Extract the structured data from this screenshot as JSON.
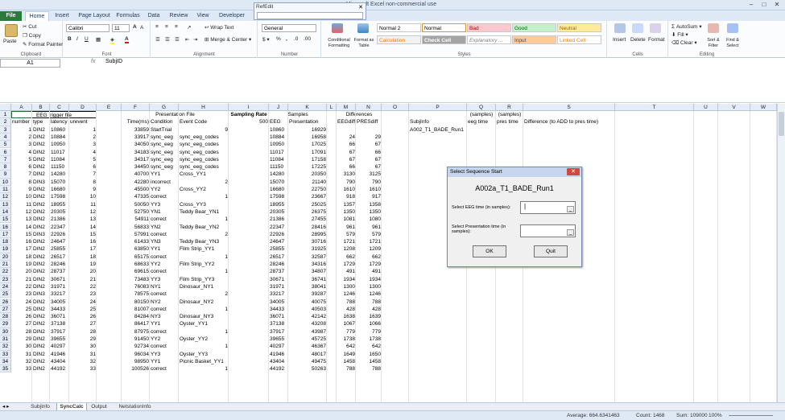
{
  "title_bar": {
    "file_tab": "File",
    "title": "c - Microsoft Excel non-commercial use"
  },
  "refedit": {
    "title": "RefEdit"
  },
  "ribbon_tabs": [
    "Home",
    "Insert",
    "Page Layout",
    "Formulas",
    "Data",
    "Review",
    "View",
    "Developer"
  ],
  "clipboard": {
    "paste": "Paste",
    "cut": "Cut",
    "copy": "Copy",
    "format_painter": "Format Painter",
    "label": "Clipboard"
  },
  "font": {
    "name": "Calibri",
    "size": "11",
    "label": "Font"
  },
  "alignment": {
    "wrap": "Wrap Text",
    "merge": "Merge & Center",
    "label": "Alignment"
  },
  "number": {
    "format": "General",
    "label": "Number"
  },
  "styles": {
    "conditional": "Conditional Formatting",
    "format_table": "Format as Table",
    "cells": [
      {
        "label": "Normal 2",
        "bg": "#ffffff",
        "color": "#000000"
      },
      {
        "label": "Normal",
        "bg": "#ffffff",
        "color": "#000000"
      },
      {
        "label": "Bad",
        "bg": "#ffc7ce",
        "color": "#9c0006"
      },
      {
        "label": "Good",
        "bg": "#c6efce",
        "color": "#006100"
      },
      {
        "label": "Neutral",
        "bg": "#ffeb9c",
        "color": "#9c6500"
      },
      {
        "label": "Calculation",
        "bg": "#f2f2f2",
        "color": "#fa7d00"
      },
      {
        "label": "Check Cell",
        "bg": "#a5a5a5",
        "color": "#ffffff"
      },
      {
        "label": "Explanatory ...",
        "bg": "#ffffff",
        "color": "#7f7f7f"
      },
      {
        "label": "Input",
        "bg": "#ffcc99",
        "color": "#3f3f76"
      },
      {
        "label": "Linked Cell",
        "bg": "#ffffff",
        "color": "#fa7d00"
      }
    ],
    "label": "Styles"
  },
  "cells_group": {
    "insert": "Insert",
    "delete": "Delete",
    "format": "Format",
    "label": "Cells"
  },
  "editing": {
    "autosum": "AutoSum",
    "fill": "Fill",
    "clear": "Clear",
    "sort": "Sort & Filter",
    "find": "Find & Select",
    "label": "Editing"
  },
  "formula_bar": {
    "name_box": "A1",
    "fx": "fx",
    "content": "SubjID"
  },
  "columns": [
    "A",
    "B",
    "C",
    "D",
    "E",
    "F",
    "G",
    "H",
    "I",
    "J",
    "K",
    "L",
    "M",
    "N",
    "O",
    "P",
    "Q",
    "R",
    "S",
    "T",
    "U",
    "V",
    "W"
  ],
  "header_row1": {
    "eeg": "EEG trigger file",
    "pres": "Presentation File",
    "sampling_rate": "Sampling Rate",
    "samples": "Samples",
    "differences": "Differences",
    "q": "(samples)",
    "r": "(samples)"
  },
  "header_row2": {
    "a": "number",
    "b": "type",
    "c": "latency",
    "d": "urevent",
    "f": "Time(ms)",
    "g": "Condition",
    "h": "Event Code",
    "i": "500",
    "j": "EEG",
    "k": "Presentation",
    "m": "EEGdiff",
    "n": "PRESdiff",
    "p": "SubjInfo",
    "q": "eeg time",
    "r": "pres time",
    "s": "Difference (to ADD to pres time)"
  },
  "p3": "A002_T1_BADE_Run1",
  "rows": [
    {
      "a": "1",
      "b": "DIN2",
      "c": "10860",
      "d": "1",
      "f": "33859",
      "g": "StartTrial",
      "h": "",
      "hn": "9",
      "j": "10860",
      "k": "16929",
      "m": "",
      "n": ""
    },
    {
      "a": "2",
      "b": "DIN2",
      "c": "10884",
      "d": "2",
      "f": "33917",
      "g": "sync_eeg",
      "h": "sync_eeg_codes",
      "hn": "",
      "j": "10884",
      "k": "16958",
      "m": "24",
      "n": "29"
    },
    {
      "a": "3",
      "b": "DIN2",
      "c": "10950",
      "d": "3",
      "f": "34050",
      "g": "sync_eeg",
      "h": "sync_eeg_codes",
      "hn": "",
      "j": "10950",
      "k": "17025",
      "m": "66",
      "n": "67"
    },
    {
      "a": "4",
      "b": "DIN2",
      "c": "11017",
      "d": "4",
      "f": "34183",
      "g": "sync_eeg",
      "h": "sync_eeg_codes",
      "hn": "",
      "j": "11017",
      "k": "17091",
      "m": "67",
      "n": "66"
    },
    {
      "a": "5",
      "b": "DIN2",
      "c": "11084",
      "d": "5",
      "f": "34317",
      "g": "sync_eeg",
      "h": "sync_eeg_codes",
      "hn": "",
      "j": "11084",
      "k": "17158",
      "m": "67",
      "n": "67"
    },
    {
      "a": "6",
      "b": "DIN2",
      "c": "11150",
      "d": "6",
      "f": "34450",
      "g": "sync_eeg",
      "h": "sync_eeg_codes",
      "hn": "",
      "j": "11150",
      "k": "17225",
      "m": "66",
      "n": "67"
    },
    {
      "a": "7",
      "b": "DIN2",
      "c": "14280",
      "d": "7",
      "f": "40700",
      "g": "YY1",
      "h": "Cross_YY1",
      "hn": "",
      "j": "14280",
      "k": "20350",
      "m": "3130",
      "n": "3125"
    },
    {
      "a": "8",
      "b": "DIN3",
      "c": "15070",
      "d": "8",
      "f": "42280",
      "g": "incorrect",
      "h": "",
      "hn": "2",
      "j": "15070",
      "k": "21140",
      "m": "790",
      "n": "790"
    },
    {
      "a": "9",
      "b": "DIN2",
      "c": "16680",
      "d": "9",
      "f": "45500",
      "g": "YY2",
      "h": "Cross_YY2",
      "hn": "",
      "j": "16680",
      "k": "22750",
      "m": "1610",
      "n": "1610"
    },
    {
      "a": "10",
      "b": "DIN2",
      "c": "17598",
      "d": "10",
      "f": "47335",
      "g": "correct",
      "h": "",
      "hn": "1",
      "j": "17598",
      "k": "23667",
      "m": "918",
      "n": "917"
    },
    {
      "a": "11",
      "b": "DIN2",
      "c": "18955",
      "d": "11",
      "f": "50050",
      "g": "YY3",
      "h": "Cross_YY3",
      "hn": "",
      "j": "18955",
      "k": "25025",
      "m": "1357",
      "n": "1358"
    },
    {
      "a": "12",
      "b": "DIN2",
      "c": "20305",
      "d": "12",
      "f": "52750",
      "g": "YN1",
      "h": "Teddy Bear_YN1",
      "hn": "",
      "j": "20305",
      "k": "26375",
      "m": "1350",
      "n": "1350"
    },
    {
      "a": "13",
      "b": "DIN2",
      "c": "21386",
      "d": "13",
      "f": "54911",
      "g": "correct",
      "h": "",
      "hn": "1",
      "j": "21386",
      "k": "27455",
      "m": "1081",
      "n": "1080"
    },
    {
      "a": "14",
      "b": "DIN2",
      "c": "22347",
      "d": "14",
      "f": "56833",
      "g": "YN2",
      "h": "Teddy Bear_YN2",
      "hn": "",
      "j": "22347",
      "k": "28416",
      "m": "961",
      "n": "961"
    },
    {
      "a": "15",
      "b": "DIN3",
      "c": "22926",
      "d": "15",
      "f": "57991",
      "g": "correct",
      "h": "",
      "hn": "2",
      "j": "22926",
      "k": "28995",
      "m": "579",
      "n": "579"
    },
    {
      "a": "16",
      "b": "DIN2",
      "c": "24647",
      "d": "16",
      "f": "61433",
      "g": "YN3",
      "h": "Teddy Bear_YN3",
      "hn": "",
      "j": "24647",
      "k": "30716",
      "m": "1721",
      "n": "1721"
    },
    {
      "a": "17",
      "b": "DIN2",
      "c": "25855",
      "d": "17",
      "f": "63850",
      "g": "YY1",
      "h": "Film Strip_YY1",
      "hn": "",
      "j": "25855",
      "k": "31925",
      "m": "1208",
      "n": "1209"
    },
    {
      "a": "18",
      "b": "DIN2",
      "c": "26517",
      "d": "18",
      "f": "65175",
      "g": "correct",
      "h": "",
      "hn": "1",
      "j": "26517",
      "k": "32587",
      "m": "662",
      "n": "662"
    },
    {
      "a": "19",
      "b": "DIN2",
      "c": "28246",
      "d": "19",
      "f": "68633",
      "g": "YY2",
      "h": "Film Strip_YY2",
      "hn": "",
      "j": "28246",
      "k": "34316",
      "m": "1729",
      "n": "1729"
    },
    {
      "a": "20",
      "b": "DIN2",
      "c": "28737",
      "d": "20",
      "f": "69615",
      "g": "correct",
      "h": "",
      "hn": "1",
      "j": "28737",
      "k": "34807",
      "m": "491",
      "n": "491"
    },
    {
      "a": "21",
      "b": "DIN2",
      "c": "30671",
      "d": "21",
      "f": "73483",
      "g": "YY3",
      "h": "Film Strip_YY3",
      "hn": "",
      "j": "30671",
      "k": "36741",
      "m": "1934",
      "n": "1934"
    },
    {
      "a": "22",
      "b": "DIN2",
      "c": "31971",
      "d": "22",
      "f": "76083",
      "g": "NY1",
      "h": "Dinosaur_NY1",
      "hn": "",
      "j": "31971",
      "k": "38041",
      "m": "1300",
      "n": "1300"
    },
    {
      "a": "23",
      "b": "DIN3",
      "c": "33217",
      "d": "23",
      "f": "78575",
      "g": "correct",
      "h": "",
      "hn": "2",
      "j": "33217",
      "k": "39287",
      "m": "1246",
      "n": "1246"
    },
    {
      "a": "24",
      "b": "DIN2",
      "c": "34005",
      "d": "24",
      "f": "80150",
      "g": "NY2",
      "h": "Dinosaur_NY2",
      "hn": "",
      "j": "34005",
      "k": "40075",
      "m": "788",
      "n": "788"
    },
    {
      "a": "25",
      "b": "DIN2",
      "c": "34433",
      "d": "25",
      "f": "81007",
      "g": "correct",
      "h": "",
      "hn": "1",
      "j": "34433",
      "k": "40503",
      "m": "428",
      "n": "428"
    },
    {
      "a": "26",
      "b": "DIN2",
      "c": "36071",
      "d": "26",
      "f": "84284",
      "g": "NY3",
      "h": "Dinosaur_NY3",
      "hn": "",
      "j": "36071",
      "k": "42142",
      "m": "1638",
      "n": "1639"
    },
    {
      "a": "27",
      "b": "DIN2",
      "c": "37138",
      "d": "27",
      "f": "86417",
      "g": "YY1",
      "h": "Oyster_YY1",
      "hn": "",
      "j": "37138",
      "k": "43208",
      "m": "1067",
      "n": "1066"
    },
    {
      "a": "28",
      "b": "DIN2",
      "c": "37917",
      "d": "28",
      "f": "87975",
      "g": "correct",
      "h": "",
      "hn": "1",
      "j": "37917",
      "k": "43987",
      "m": "779",
      "n": "779"
    },
    {
      "a": "29",
      "b": "DIN2",
      "c": "39655",
      "d": "29",
      "f": "91450",
      "g": "YY2",
      "h": "Oyster_YY2",
      "hn": "",
      "j": "39655",
      "k": "45725",
      "m": "1738",
      "n": "1738"
    },
    {
      "a": "30",
      "b": "DIN2",
      "c": "40297",
      "d": "30",
      "f": "92734",
      "g": "correct",
      "h": "",
      "hn": "1",
      "j": "40297",
      "k": "46367",
      "m": "642",
      "n": "642"
    },
    {
      "a": "31",
      "b": "DIN2",
      "c": "41946",
      "d": "31",
      "f": "96034",
      "g": "YY3",
      "h": "Oyster_YY3",
      "hn": "",
      "j": "41946",
      "k": "48017",
      "m": "1649",
      "n": "1650"
    },
    {
      "a": "32",
      "b": "DIN2",
      "c": "43404",
      "d": "32",
      "f": "98950",
      "g": "YY1",
      "h": "Picnic Basket_YY1",
      "hn": "",
      "j": "43404",
      "k": "49475",
      "m": "1458",
      "n": "1458"
    },
    {
      "a": "33",
      "b": "DIN2",
      "c": "44192",
      "d": "33",
      "f": "100526",
      "g": "correct",
      "h": "",
      "hn": "1",
      "j": "44192",
      "k": "50263",
      "m": "788",
      "n": "788"
    }
  ],
  "sheet_tabs": [
    "SubjInfo",
    "SyncCalc",
    "Output",
    "NetstationInfo"
  ],
  "status": {
    "average": "Average: 664.6341463",
    "count": "Count: 1468",
    "sum": "Sum: 109000",
    "zoom": "100%"
  },
  "dialog": {
    "title": "Select Sequence Start",
    "close": "✕",
    "subject": "A002a_T1_BADE_Run1",
    "eeg_label": "Select EEG time (in samples):",
    "pres_label": "Select Presentation time (in samples):",
    "eeg_value": "|",
    "pres_value": "",
    "ok": "OK",
    "quit": "Quit"
  }
}
